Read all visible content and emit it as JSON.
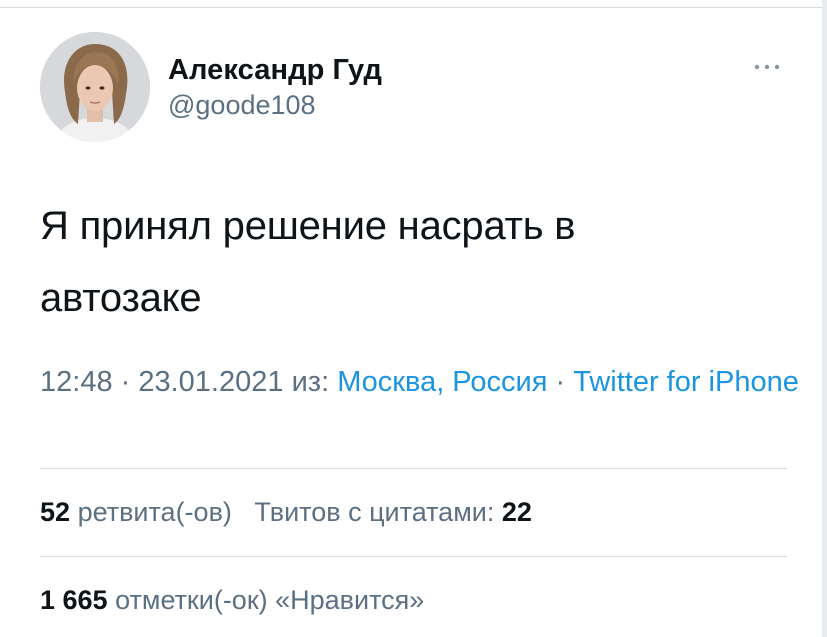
{
  "author": {
    "name": "Александр Гуд",
    "handle": "@goode108"
  },
  "icons": {
    "more": "more-horizontal-icon"
  },
  "tweet": {
    "text_line1": "Я принял решение насрать в",
    "text_line2": "автозаке"
  },
  "meta": {
    "time": "12:48",
    "sep1": " · ",
    "date": "23.01.2021",
    "from_label": " из: ",
    "location": "Москва, Россия",
    "sep2": " · ",
    "source": "Twitter for iPhone"
  },
  "stats": {
    "retweets_count": "52",
    "retweets_label": "ретвита(-ов)",
    "quotes_label": "Твитов с цитатами:",
    "quotes_count": "22",
    "likes_count": "1 665",
    "likes_label": "отметки(-ок) «Нравится»"
  },
  "colors": {
    "text": "#0f1419",
    "secondary": "#5b7083",
    "link": "#1b95e0",
    "divider": "#d9dde0"
  }
}
